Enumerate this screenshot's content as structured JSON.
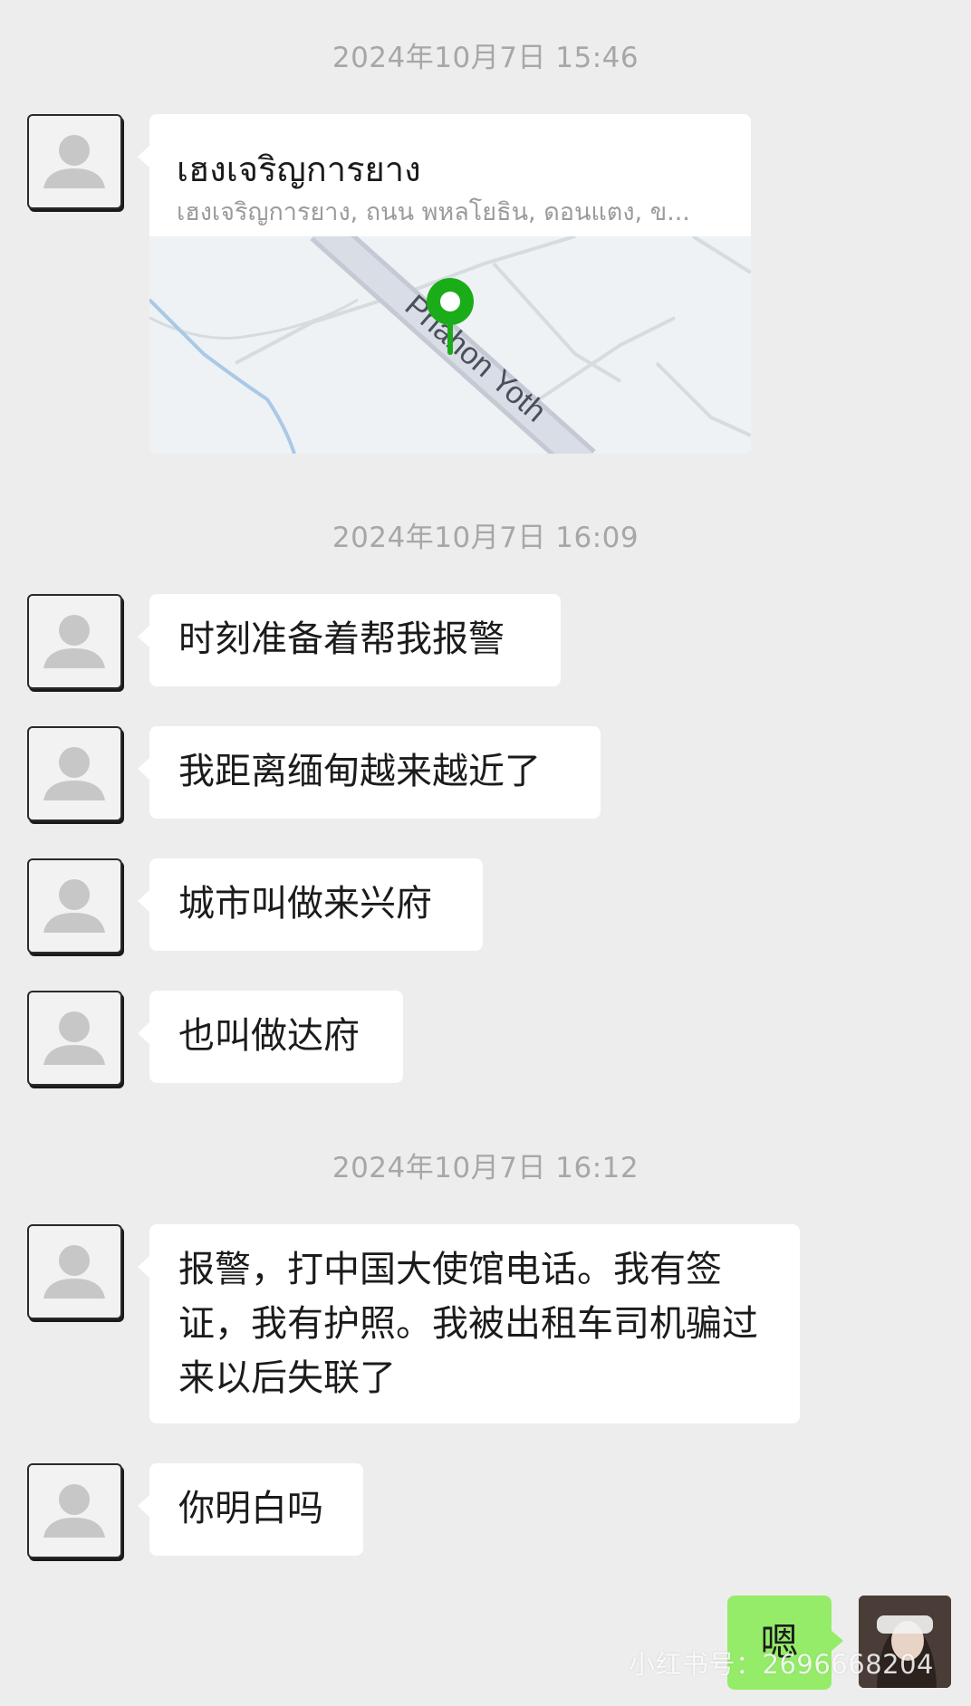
{
  "messages_area": {
    "timestamps": [
      "2024年10月7日 15:46",
      "2024年10月7日 16:09",
      "2024年10月7日 16:12"
    ],
    "location": {
      "title": "เฮงเจริญการยาง",
      "address": "เฮงเจริญการยาง, ถนน พหลโยธิน, ดอนแตง, ข...",
      "map_road_label": "Phahon Yoth",
      "pin_color": "#1aad19"
    },
    "received": [
      "时刻准备着帮我报警",
      "我距离缅甸越来越近了",
      "城市叫做来兴府",
      "也叫做达府",
      "报警，打中国大使馆电话。我有签证，我有护照。我被出租车司机骗过来以后失联了",
      "你明白吗"
    ],
    "sent": [
      "嗯"
    ]
  },
  "watermark": "小红书号：2696668204",
  "colors": {
    "background": "#ededed",
    "received_bubble": "#ffffff",
    "sent_bubble": "#95ec69",
    "timestamp": "#a7a7a7"
  },
  "icons": {
    "contact_avatar": "default-person-icon",
    "map_pin": "location-pin-icon"
  }
}
